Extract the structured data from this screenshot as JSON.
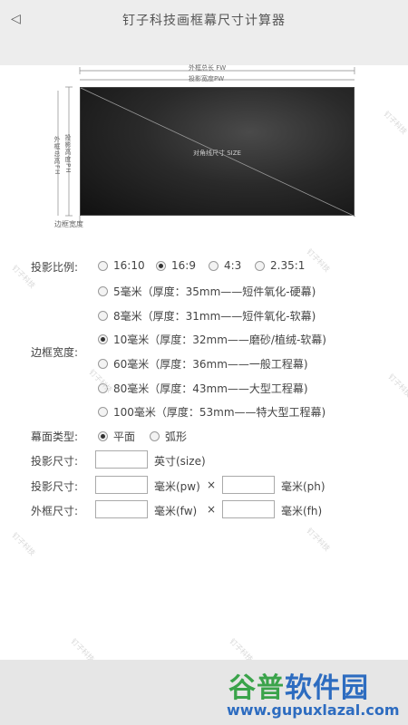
{
  "header": {
    "back_icon": "back-arrow-icon",
    "title": "钉子科技画框幕尺寸计算器"
  },
  "diagram": {
    "outer_width_label": "外框总长 FW",
    "proj_width_label": "投影宽度PW",
    "screen_label": "对角线尺寸 SIZE",
    "outer_height_label": "外框总高FH",
    "proj_height_label": "投影高度PH",
    "border_width_label": "边框宽度"
  },
  "ratio": {
    "label": "投影比例:",
    "options": [
      {
        "label": "16:10",
        "selected": false
      },
      {
        "label": "16:9",
        "selected": true
      },
      {
        "label": "4:3",
        "selected": false
      },
      {
        "label": "2.35:1",
        "selected": false
      }
    ]
  },
  "border": {
    "label": "边框宽度:",
    "options": [
      {
        "label": "5毫米（厚度：35mm——短件氧化-硬幕)",
        "selected": false
      },
      {
        "label": "8毫米（厚度：31mm——短件氧化-软幕)",
        "selected": false
      },
      {
        "label": "10毫米（厚度：32mm——磨砂/植绒-软幕)",
        "selected": true
      },
      {
        "label": "60毫米（厚度：36mm——一般工程幕)",
        "selected": false
      },
      {
        "label": "80毫米（厚度：43mm——大型工程幕)",
        "selected": false
      },
      {
        "label": "100毫米（厚度：53mm——特大型工程幕)",
        "selected": false
      }
    ]
  },
  "surface": {
    "label": "幕面类型:",
    "options": [
      {
        "label": "平面",
        "selected": true
      },
      {
        "label": "弧形",
        "selected": false
      }
    ]
  },
  "size_row": {
    "label": "投影尺寸:",
    "value": "",
    "unit": "英寸(size)"
  },
  "proj_row": {
    "label": "投影尺寸:",
    "w_value": "",
    "w_unit": "毫米(pw)",
    "times": "×",
    "h_value": "",
    "h_unit": "毫米(ph)"
  },
  "frame_row": {
    "label": "外框尺寸:",
    "w_value": "",
    "w_unit": "毫米(fw)",
    "times": "×",
    "h_value": "",
    "h_unit": "毫米(fh)"
  },
  "watermark": {
    "brand_green": "谷普",
    "brand_blue": "软件园",
    "url": "www.gupuxlazal.com",
    "tiny": "钉子科技"
  }
}
